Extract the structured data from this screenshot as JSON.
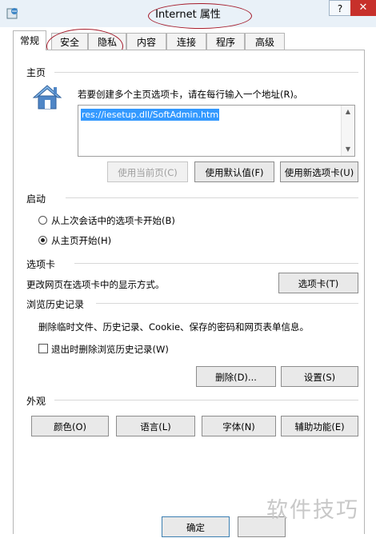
{
  "window": {
    "title": "Internet 属性",
    "help_label": "?",
    "close_label": "✕"
  },
  "tabs": [
    {
      "label": "常规",
      "active": true
    },
    {
      "label": "安全"
    },
    {
      "label": "隐私"
    },
    {
      "label": "内容"
    },
    {
      "label": "连接"
    },
    {
      "label": "程序"
    },
    {
      "label": "高级"
    }
  ],
  "home": {
    "section_label": "主页",
    "description": "若要创建多个主页选项卡，请在每行输入一个地址(R)。",
    "url_value": "res://iesetup.dll/SoftAdmin.htm",
    "buttons": {
      "use_current": "使用当前页(C)",
      "use_default": "使用默认值(F)",
      "use_new_tab": "使用新选项卡(U)"
    }
  },
  "startup": {
    "section_label": "启动",
    "option_last_session": "从上次会话中的选项卡开始(B)",
    "option_home_page": "从主页开始(H)",
    "selected": "home_page"
  },
  "tabs_section": {
    "section_label": "选项卡",
    "description": "更改网页在选项卡中的显示方式。",
    "button": "选项卡(T)"
  },
  "history": {
    "section_label": "浏览历史记录",
    "description": "删除临时文件、历史记录、Cookie、保存的密码和网页表单信息。",
    "checkbox_label": "退出时删除浏览历史记录(W)",
    "checked": false,
    "delete_button": "删除(D)...",
    "settings_button": "设置(S)"
  },
  "appearance": {
    "section_label": "外观",
    "colors_button": "颜色(O)",
    "languages_button": "语言(L)",
    "fonts_button": "字体(N)",
    "accessibility_button": "辅助功能(E)"
  },
  "footer": {
    "ok_button": "确定"
  },
  "watermark": "软件技巧",
  "colors": {
    "annotation": "#a41a2a",
    "selection": "#3399ff",
    "close": "#c7302b",
    "titlebar": "#e9f1f8"
  }
}
